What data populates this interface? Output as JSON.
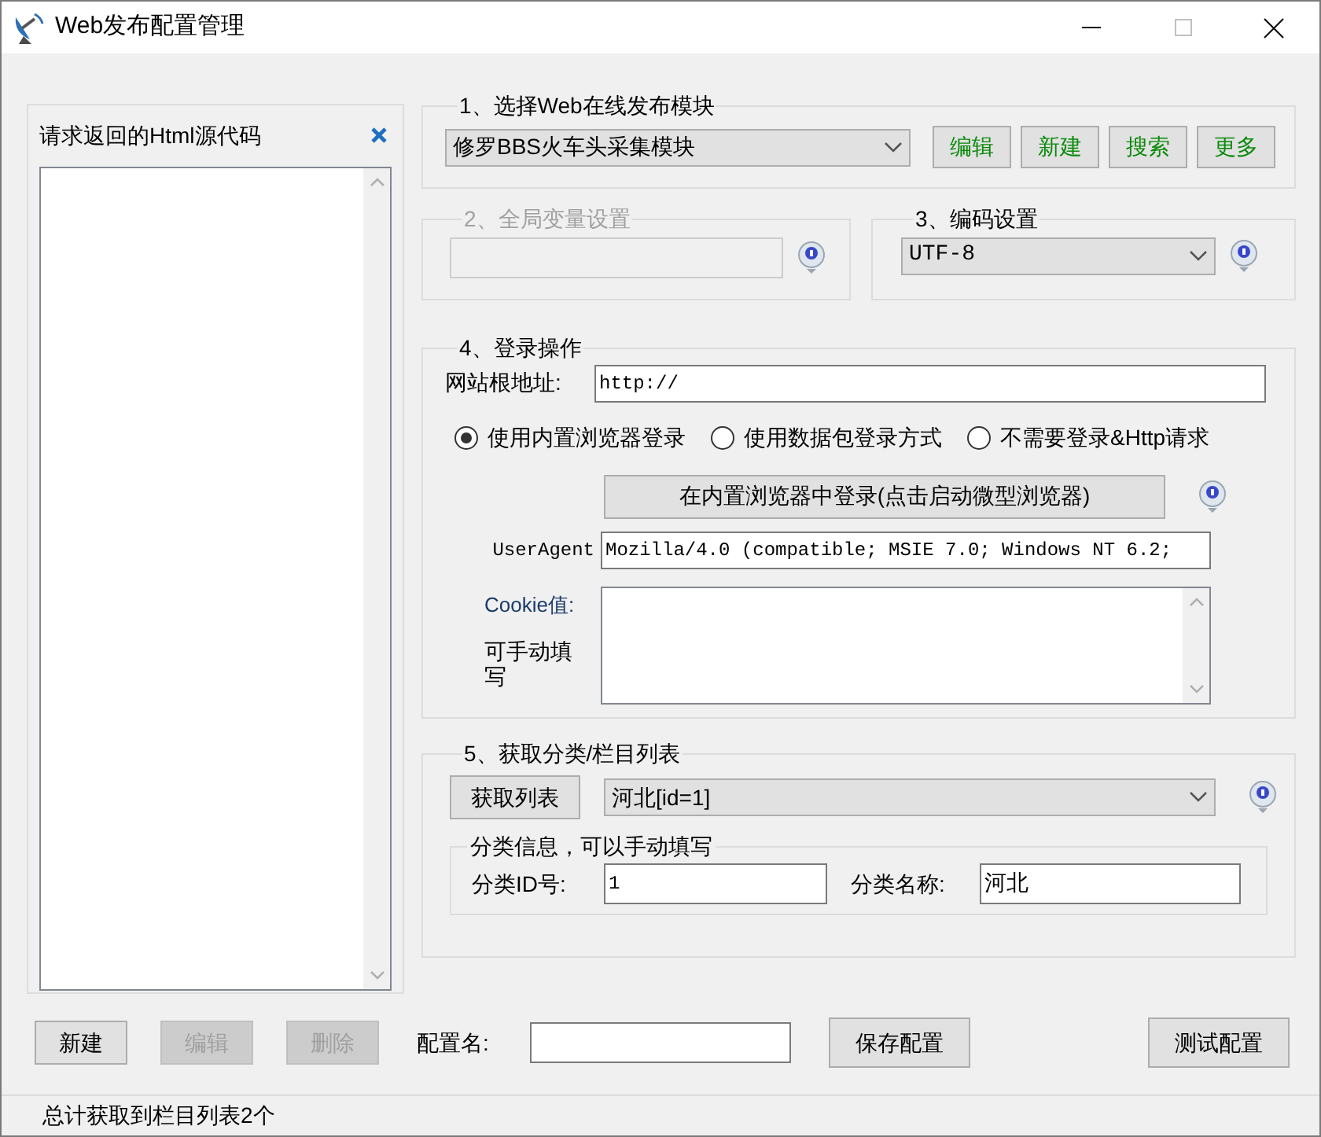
{
  "window": {
    "title": "Web发布配置管理"
  },
  "source_panel": {
    "title": "请求返回的Html源代码"
  },
  "module_group": {
    "title": "1、选择Web在线发布模块",
    "module": "修罗BBS火车头采集模块",
    "buttons": [
      "编辑",
      "新建",
      "搜索",
      "更多"
    ]
  },
  "global_vars": {
    "title": "2、全局变量设置",
    "disabled": true
  },
  "encoding": {
    "title": "3、编码设置",
    "value": "UTF-8"
  },
  "login": {
    "title": "4、登录操作",
    "root_url_label": "网站根地址:",
    "root_url": "http://",
    "methods": [
      {
        "label": "使用内置浏览器登录",
        "selected": true
      },
      {
        "label": "使用数据包登录方式",
        "selected": false
      },
      {
        "label": "不需要登录&Http请求",
        "selected": false
      }
    ],
    "browser_button": "在内置浏览器中登录(点击启动微型浏览器)",
    "user_agent_label": "UserAgent",
    "user_agent": "Mozilla/4.0 (compatible; MSIE 7.0; Windows NT 6.2;",
    "cookie_label": "Cookie值:",
    "cookie_hint": "可手动填写"
  },
  "category": {
    "title": "5、获取分类/栏目列表",
    "fetch_button": "获取列表",
    "selected_category": "河北[id=1]",
    "info_title": "分类信息，可以手动填写",
    "id_label": "分类ID号:",
    "id": "1",
    "name_label": "分类名称:",
    "name": "河北"
  },
  "config_buttons": [
    {
      "label": "新建",
      "disabled": false
    },
    {
      "label": "编辑",
      "disabled": true
    },
    {
      "label": "删除",
      "disabled": true
    }
  ],
  "config_name_label": "配置名:",
  "save_button": "保存配置",
  "test_button": "测试配置",
  "status_bar": "总计获取到栏目列表2个"
}
